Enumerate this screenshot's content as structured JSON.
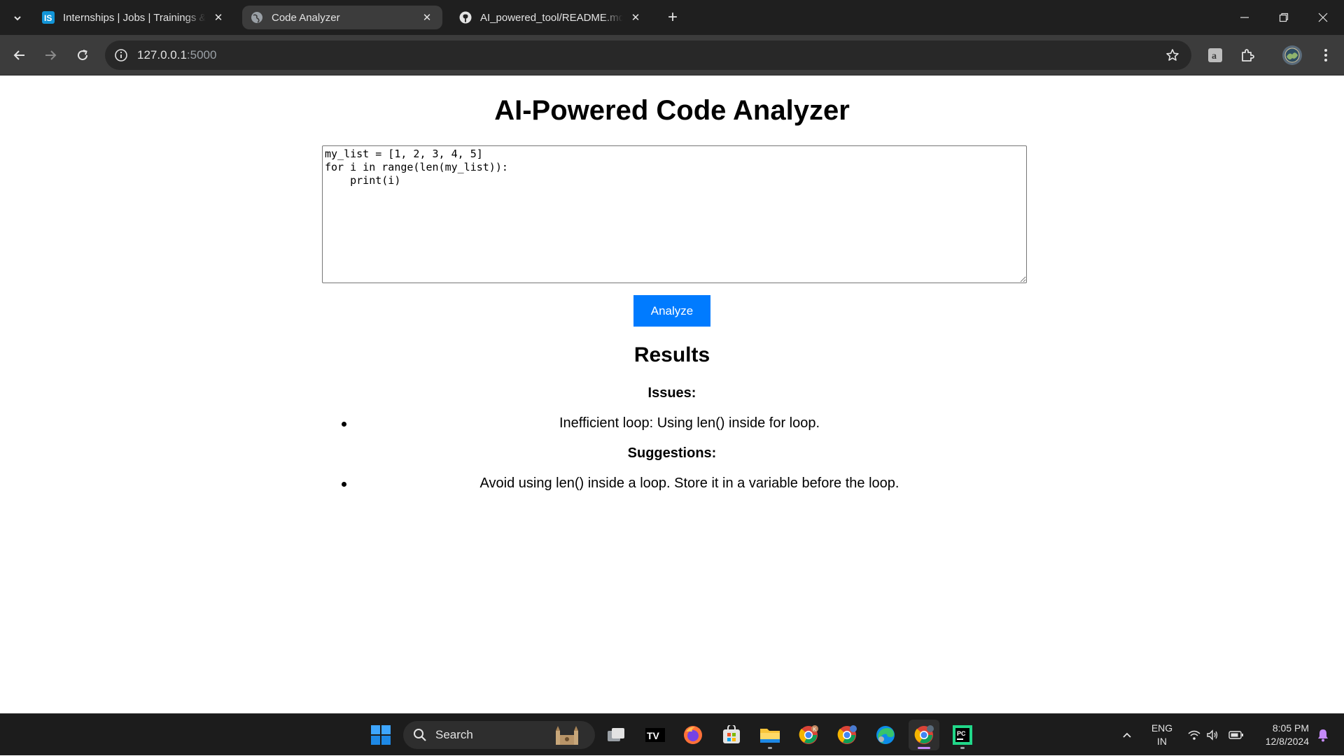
{
  "browser": {
    "tabs": [
      {
        "title": "Internships | Jobs | Trainings & Placements",
        "favicon": "internshala-icon",
        "active": false
      },
      {
        "title": "Code Analyzer",
        "favicon": "globe-icon",
        "active": true
      },
      {
        "title": "AI_powered_tool/README.md at main",
        "favicon": "github-icon",
        "active": false
      }
    ],
    "close_glyph": "✕",
    "new_tab_glyph": "+",
    "url_host": "127.0.0.1",
    "url_port": ":5000"
  },
  "page": {
    "title": "AI-Powered Code Analyzer",
    "code": "my_list = [1, 2, 3, 4, 5]\nfor i in range(len(my_list)):\n    print(i)",
    "analyze_label": "Analyze",
    "results_heading": "Results",
    "issues_heading": "Issues:",
    "issues": [
      "Inefficient loop: Using len() inside for loop."
    ],
    "suggestions_heading": "Suggestions:",
    "suggestions": [
      "Avoid using len() inside a loop. Store it in a variable before the loop."
    ],
    "accent_color": "#007bff"
  },
  "taskbar": {
    "search_label": "Search",
    "language": "ENG",
    "region": "IN",
    "time": "8:05 PM",
    "date": "12/8/2024"
  }
}
